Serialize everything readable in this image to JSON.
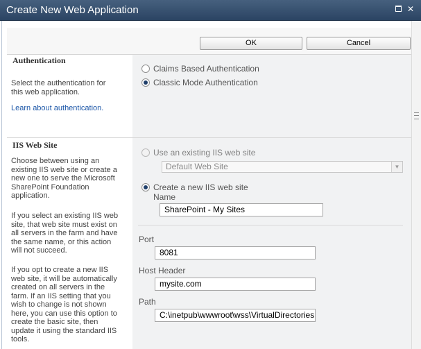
{
  "window": {
    "title": "Create New Web Application"
  },
  "buttons": {
    "ok": "OK",
    "cancel": "Cancel"
  },
  "authentication": {
    "title": "Authentication",
    "description": "Select the authentication for this web application.",
    "link": "Learn about authentication.",
    "options": [
      {
        "label": "Claims Based Authentication",
        "checked": false
      },
      {
        "label": "Classic Mode Authentication",
        "checked": true
      }
    ]
  },
  "iis": {
    "title": "IIS Web Site",
    "desc1": "Choose between using an existing IIS web site or create a new one to serve the Microsoft SharePoint Foundation application.",
    "desc2": "If you select an existing IIS web site, that web site must exist on all servers in the farm and have the same name, or this action will not succeed.",
    "desc3": "If you opt to create a new IIS web site, it will be automatically created on all servers in the farm.  If an IIS setting that you wish to change is not shown here, you can use this option to create the basic site, then update it using the standard IIS tools.",
    "use_existing_label": "Use an existing IIS web site",
    "existing_site_selected": "Default Web Site",
    "create_new_label": "Create a new IIS web site",
    "name_label": "Name",
    "name_value": "SharePoint - My Sites",
    "port_label": "Port",
    "port_value": "8081",
    "host_header_label": "Host Header",
    "host_header_value": "mysite.com",
    "path_label": "Path",
    "path_value": "C:\\inetpub\\wwwroot\\wss\\VirtualDirectories"
  }
}
